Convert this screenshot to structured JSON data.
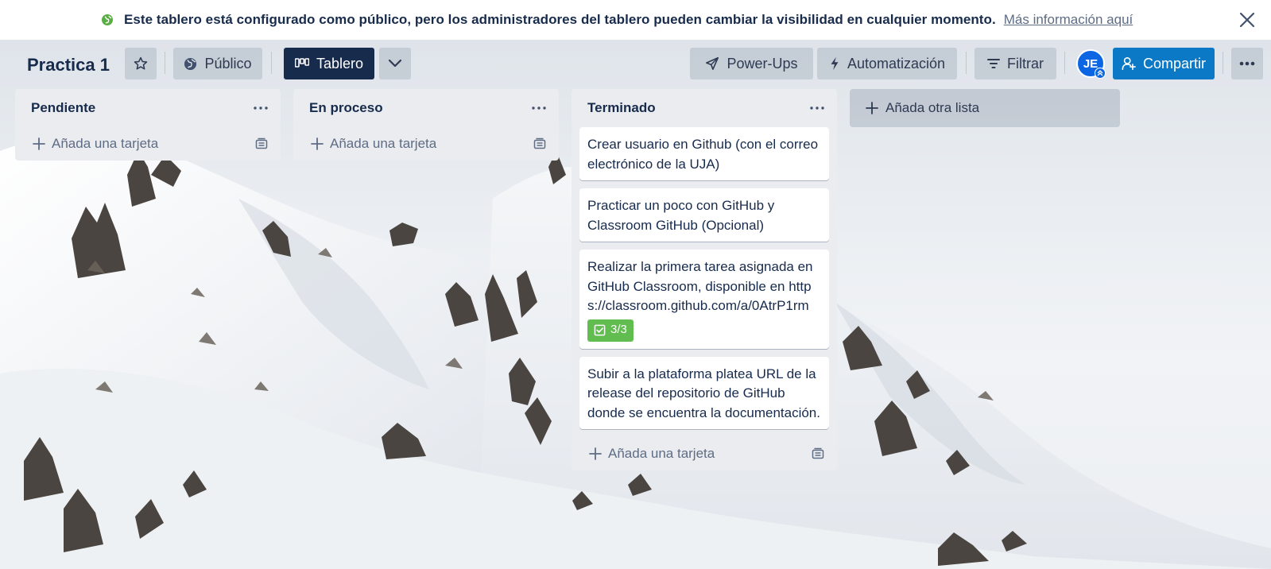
{
  "banner": {
    "message": "Este tablero está configurado como público, pero los administradores del tablero pueden cambiar la visibilidad en cualquier momento.",
    "link": "Más información aquí"
  },
  "header": {
    "title": "Practica 1",
    "visibility": "Público",
    "view": "Tablero",
    "powerups": "Power-Ups",
    "automation": "Automatización",
    "filter": "Filtrar",
    "avatar_initials": "JE",
    "share": "Compartir"
  },
  "lists": [
    {
      "title": "Pendiente",
      "add_card": "Añada una tarjeta",
      "cards": []
    },
    {
      "title": "En proceso",
      "add_card": "Añada una tarjeta",
      "cards": []
    },
    {
      "title": "Terminado",
      "add_card": "Añada una tarjeta",
      "cards": [
        {
          "text": "Crear usuario en Github (con el correo electrónico de la UJA)"
        },
        {
          "text": "Practicar un poco con GitHub y Classroom GitHub (Opcional)"
        },
        {
          "text": "Realizar la primera tarea asignada en GitHub Classroom, disponible en https://classroom.github.com/a/0AtrP1rm",
          "checklist": "3/3"
        },
        {
          "text": "Subir a la plataforma platea URL de la release del repositorio de GitHub donde se encuentra la documentación."
        }
      ]
    }
  ],
  "add_list": "Añada otra lista",
  "colors": {
    "brand_dark": "#172b4d",
    "share_blue": "#0c79c6",
    "checklist_green": "#61bd4f",
    "list_bg": "#ebecf0",
    "banner_globe": "#5aac44"
  }
}
